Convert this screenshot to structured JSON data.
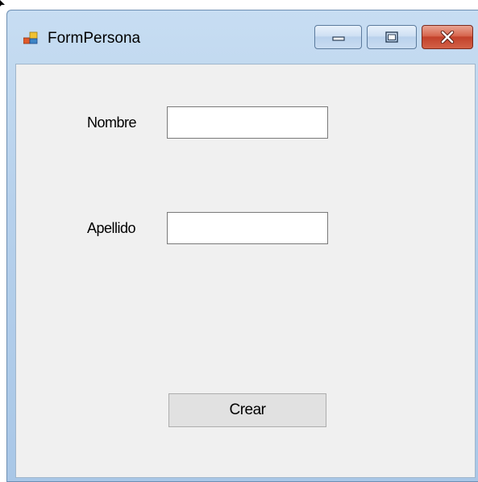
{
  "window": {
    "title": "FormPersona",
    "controls": {
      "minimize": "minimize",
      "maximize": "maximize",
      "close": "close"
    }
  },
  "form": {
    "nombre": {
      "label": "Nombre",
      "value": ""
    },
    "apellido": {
      "label": "Apellido",
      "value": ""
    },
    "crear_button": "Crear"
  },
  "colors": {
    "client_bg": "#f0f0f0",
    "close_button": "#c94a33",
    "titlebar": "#b7d1ec"
  }
}
